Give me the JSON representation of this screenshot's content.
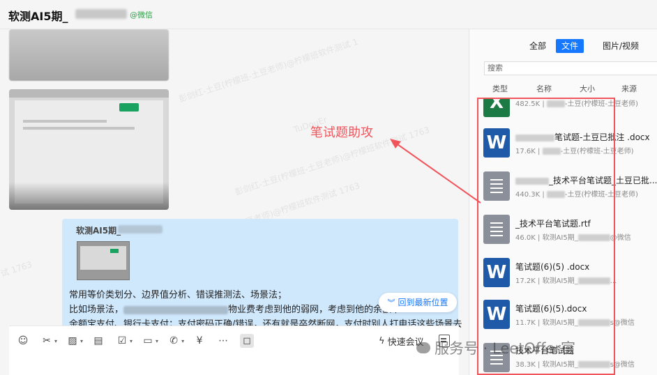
{
  "header": {
    "group_title": "软测AI5期_",
    "wechat_tag": "@微信"
  },
  "chat": {
    "watermarks": [
      "彭剑红-土豆(柠檬班-土豆老师)@柠檬班软件测试 1",
      "TuDouEr",
      "彭剑红-土豆(柠檬班-土豆老师)@柠檬班软件测试 1763",
      "彭剑红-土豆(柠檬班-土豆老师)@柠檬班软件测试 1763",
      "试 1763"
    ],
    "quote_title": "软测AI5期_",
    "message_lines": [
      "常用等价类划分、边界值分析、错误推测法、场景法；",
      "比如场景法，",
      "物业费考虑到他的弱网，考虑到他的余额不",
      "余额宝支付、银行卡支付；支付密码正确/错误，还有就是卒然断网，支付时别人打电话这些场景去"
    ],
    "jump_button_label": "回到最新位置"
  },
  "composer": {
    "toolbar_icons": [
      "emoji-icon",
      "scissors-icon",
      "image-icon",
      "note-icon",
      "task-icon",
      "folder-icon",
      "phone-icon",
      "payment-icon",
      "more-icon",
      "screen-icon"
    ],
    "quick_meeting_label": "快速会议"
  },
  "panel": {
    "tabs": [
      "全部",
      "文件",
      "图片/视频"
    ],
    "active_tab": "文件",
    "search_placeholder": "搜索",
    "columns": [
      "类型",
      "名称",
      "大小",
      "来源"
    ],
    "files": [
      {
        "type": "excel",
        "glyph": "X",
        "name": "",
        "meta_size": "482.5K",
        "meta_source": "土豆(柠檬班-土豆老师)"
      },
      {
        "type": "word",
        "glyph": "W",
        "name": "笔试题-土豆已批注 .docx",
        "meta_size": "17.6K",
        "meta_source": "土豆(柠檬班-土豆老师)"
      },
      {
        "type": "text",
        "glyph": "",
        "name": "_技术平台笔试题_土豆已批...",
        "meta_size": "440.3K",
        "meta_source": "土豆(柠檬班-土豆老师)"
      },
      {
        "type": "text",
        "glyph": "",
        "name": "_技术平台笔试题.rtf",
        "meta_size": "46.0K",
        "meta_source": "软测AI5期_",
        "meta_tail": "@微信"
      },
      {
        "type": "word",
        "glyph": "W",
        "name": "笔试题(6)(5) .docx",
        "meta_size": "17.2K",
        "meta_source": "软测AI5期_",
        "meta_tail": "..."
      },
      {
        "type": "word",
        "glyph": "W",
        "name": "笔试题(6)(5).docx",
        "meta_size": "11.7K",
        "meta_source": "软测AI5期_",
        "meta_tail": "s@微信"
      },
      {
        "type": "text",
        "glyph": "",
        "name": "技术平台笔试题",
        "meta_size": "38.3K",
        "meta_source": "软测AI5期_",
        "meta_tail": "s@微信"
      }
    ]
  },
  "annotation": {
    "label": "笔试题助攻",
    "color": "#f2545b"
  },
  "brand_watermark": "服务号 · LeetOffer官",
  "colors": {
    "accent": "#1677ff",
    "bubble": "#d0e8fc",
    "wechat_green": "#2ba245"
  }
}
